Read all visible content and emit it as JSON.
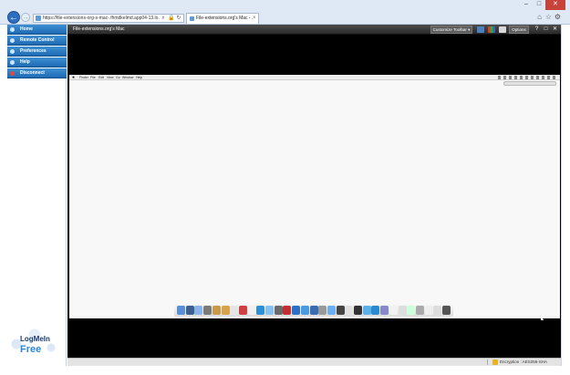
{
  "browser": {
    "url": "https://file-extensions-org-s-mac-.fhmdkelmd.app04-13.lo...",
    "tab_title": "File-extensions.org's Mac - ...",
    "tab_close": "×",
    "search_glyph": "⌕",
    "lock_glyph": "🔒",
    "refresh_glyph": "↻",
    "back_glyph": "←",
    "forward_glyph": "→",
    "window_controls": [
      "–",
      "□",
      "✕"
    ],
    "tools_glyphs": [
      "⌂",
      "☆",
      "⚙"
    ]
  },
  "sidebar": {
    "items": [
      {
        "label": "Home",
        "icon": "home-icon"
      },
      {
        "label": "Remote Control",
        "icon": "remote-icon"
      },
      {
        "label": "Preferences",
        "icon": "gear-icon"
      },
      {
        "label": "Help",
        "icon": "help-icon"
      },
      {
        "label": "Disconnect",
        "icon": "disconnect-icon"
      }
    ],
    "logo_line1": "LogMeIn",
    "logo_line2": "Free"
  },
  "remote": {
    "title": "File-extensions.org's Mac",
    "customize_toolbar": "Customize Toolbar ▾",
    "options": "Options",
    "controls": [
      "?",
      "□",
      "✕"
    ],
    "mac_menu": [
      "Finder",
      "File",
      "Edit",
      "View",
      "Go",
      "Window",
      "Help"
    ],
    "dock_icon_colors": [
      "#5a8ed6",
      "#3d5f8f",
      "#8bb4e8",
      "#7a7a7a",
      "#c99a4a",
      "#d8a24c",
      "#e5e5e5",
      "#d04040",
      "#f0f0f0",
      "#2f8fd6",
      "#88c0f0",
      "#6a6a6a",
      "#c03030",
      "#2a70c8",
      "#4a9ae0",
      "#3a6ab0",
      "#999",
      "#6cb0f2",
      "#444",
      "#e0e0e0",
      "#333",
      "#5ab0e8",
      "#2a8ad0",
      "#88c",
      "#f2f2f2",
      "#ddd",
      "#cfd",
      "#aaa",
      "#eee",
      "#ddd",
      "#555"
    ]
  },
  "status": {
    "encryption": "Encryption : AES256-SHA"
  }
}
